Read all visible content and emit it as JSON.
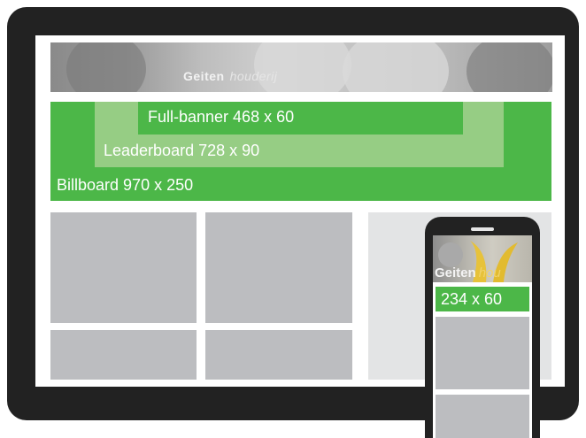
{
  "hero": {
    "logo_main": "Geiten",
    "logo_sub": "houderij"
  },
  "ads": {
    "fullbanner_label": "Full-banner 468 x 60",
    "leaderboard_label": "Leaderboard 728 x 90",
    "billboard_label": "Billboard 970 x 250",
    "mobile_label": "234 x 60"
  },
  "mobile_hero": {
    "logo_main": "Geiten",
    "logo_sub": "hou"
  },
  "colors": {
    "device_frame": "#222222",
    "ad_green": "#4cb748",
    "ad_green_light": "#96cd84",
    "content_gray": "#bcbdc0",
    "panel_gray": "#e3e4e5"
  }
}
